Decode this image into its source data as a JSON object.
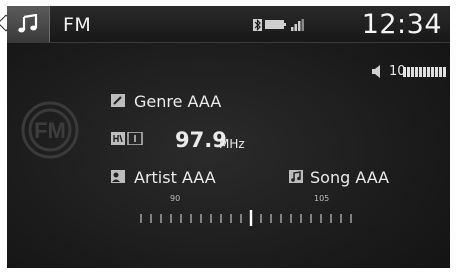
{
  "header": {
    "title": "FM",
    "clock": "12:34",
    "status_icons": [
      "bluetooth-icon",
      "battery-icon",
      "signal-icon"
    ]
  },
  "volume": {
    "value": "10",
    "level": 1.0
  },
  "station": {
    "badge": "FM",
    "genre": "Genre AAA",
    "frequency": "97.9",
    "unit": "MHz",
    "artist": "Artist AAA",
    "song": "Song AAA",
    "tuner_label_left": "90",
    "tuner_label_right": "105"
  },
  "colors": {
    "background": "#1b1b1b",
    "text": "#eaeaea",
    "tab": "#4a4a4a"
  }
}
